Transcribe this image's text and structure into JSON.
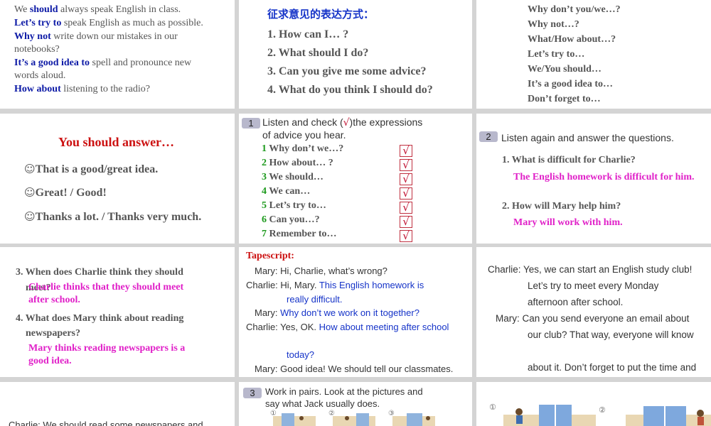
{
  "p1": {
    "lines": [
      [
        {
          "t": "We ",
          "c": "grey"
        },
        {
          "t": "should",
          "c": "blue"
        },
        {
          "t": " always speak English in class.",
          "c": "grey"
        }
      ],
      [
        {
          "t": "Let’s try to",
          "c": "blue"
        },
        {
          "t": " speak English as much as possible.",
          "c": "grey"
        }
      ],
      [
        {
          "t": "Why not",
          "c": "blue"
        },
        {
          "t": " write down our mistakes in our",
          "c": "grey"
        }
      ],
      [
        {
          "t": "notebooks?",
          "c": "grey"
        }
      ],
      [
        {
          "t": "It’s a good idea to",
          "c": "blue"
        },
        {
          "t": " spell and pronounce new",
          "c": "grey"
        }
      ],
      [
        {
          "t": "words aloud.",
          "c": "grey"
        }
      ],
      [
        {
          "t": "How about",
          "c": "blue"
        },
        {
          "t": " listening to the radio?",
          "c": "grey"
        }
      ]
    ]
  },
  "p2": {
    "heading": "征求意见的表达方式：",
    "items": [
      "1. How can I… ?",
      "2. What should I do?",
      "3. Can you give me some advice?",
      "4. What do you think I should do?"
    ]
  },
  "p3": {
    "items": [
      "Why don’t you/we…?",
      "Why not…?",
      "What/How about…?",
      "Let’s try to…",
      "We/You should…",
      "It’s a good idea to…",
      "Don’t forget to…"
    ]
  },
  "p4": {
    "title": "You should answer…",
    "smiley": "☺",
    "items": [
      "That is a good/great idea.",
      "Great! / Good!",
      "Thanks a lot. / Thanks very much."
    ]
  },
  "p5": {
    "num": "1",
    "instr1": "Listen and check (",
    "instr_mark": "√",
    "instr2": ")the expressions",
    "instr3": "of advice you hear.",
    "items": [
      {
        "n": "1",
        "t": " Why don’t we…?"
      },
      {
        "n": "2",
        "t": " How about… ?"
      },
      {
        "n": "3",
        "t": " We should…"
      },
      {
        "n": "4",
        "t": " We can…"
      },
      {
        "n": "5",
        "t": " Let’s try to…"
      },
      {
        "n": "6",
        "t": " Can you…?"
      },
      {
        "n": "7",
        "t": " Remember to…"
      }
    ],
    "check": "√"
  },
  "p6": {
    "num": "2",
    "instr": "Listen again and answer the questions.",
    "q1": "1.  What is difficult for Charlie?",
    "a1": "The English homework is difficult for him.",
    "q2": "2. How will Mary help him?",
    "a2": "Mary will work with him."
  },
  "p7": {
    "q3a": "3. When does Charlie think they should",
    "q3b": "meet?",
    "a3a": "Charlie thinks that they should meet",
    "a3b": "after school.",
    "q4a": "4. What does Mary think about reading",
    "q4b": "newspapers?",
    "a4a": "Mary thinks reading newspapers is a",
    "a4b": "good idea."
  },
  "p8": {
    "title": "Tapescript:",
    "l1": "Mary: Hi, Charlie, what’s wrong?",
    "l2a": "Charlie: Hi, Mary. ",
    "l2b": "This English homework is",
    "l3": "really difficult.",
    "l4a": "Mary: ",
    "l4b": "Why don’t we work on it together?",
    "l5a": "Charlie: Yes, OK. ",
    "l5b": "How about  meeting after school",
    "l6": "today?",
    "l7": "Mary: Good idea! We should tell our classmates."
  },
  "p9": {
    "lines": [
      "Charlie: Yes, we can start an English study club!",
      "Let’s try to meet every Monday",
      "afternoon after school.",
      "Mary: Can you send everyone an email about",
      "our club? That way, everyone will know",
      "about it. Don’t forget to put the time and"
    ]
  },
  "p10": {
    "line": "Charlie: We should read some newspapers and"
  },
  "p11": {
    "num": "3",
    "instr1": "Work in pairs. Look at the pictures and",
    "instr2": "say what Jack usually does.",
    "labels": [
      "①",
      "②",
      "③"
    ]
  },
  "p12": {
    "labels": [
      "①",
      "②"
    ]
  }
}
